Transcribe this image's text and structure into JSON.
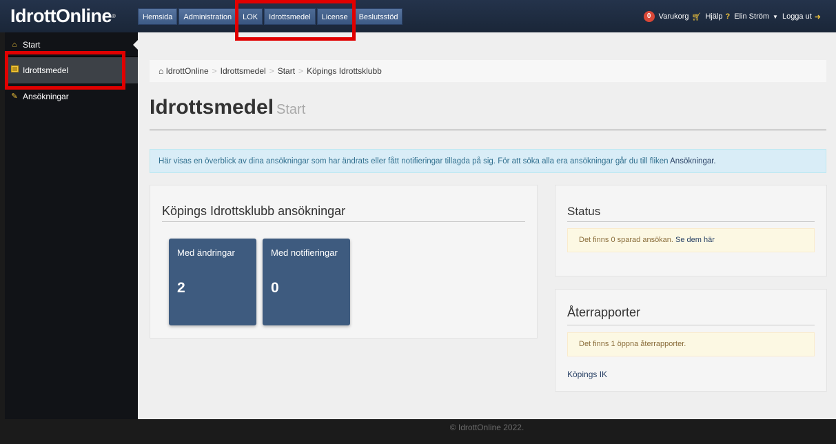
{
  "header": {
    "logo_text": "IdrottOnline",
    "nav": [
      "Hemsida",
      "Administration",
      "LOK",
      "Idrottsmedel",
      "License",
      "Beslutsstöd"
    ],
    "cart_count": "0",
    "cart_label": "Varukorg",
    "help_label": "Hjälp",
    "user_name": "Elin Ström",
    "logout_label": "Logga ut"
  },
  "sidebar": {
    "items": [
      {
        "label": "Start",
        "icon": "home-icon"
      },
      {
        "label": "Idrottsmedel",
        "icon": "list-icon"
      },
      {
        "label": "Ansökningar",
        "icon": "pencil-icon"
      }
    ]
  },
  "breadcrumb": [
    "IdrottOnline",
    "Idrottsmedel",
    "Start",
    "Köpings Idrottsklubb"
  ],
  "page": {
    "title": "Idrottsmedel",
    "subtitle": "Start",
    "info_text": "Här visas en överblick av dina ansökningar som har ändrats eller fått notifieringar tillagda på sig. För att söka alla era ansökningar går du till fliken",
    "info_link": "Ansökningar."
  },
  "applications_panel": {
    "title": "Köpings Idrottsklubb ansökningar",
    "tiles": [
      {
        "label": "Med ändringar",
        "count": "2"
      },
      {
        "label": "Med notifieringar",
        "count": "0"
      }
    ]
  },
  "status_panel": {
    "title": "Status",
    "message": "Det finns 0 sparad ansökan.",
    "link": "Se dem här"
  },
  "reports_panel": {
    "title": "Återrapporter",
    "message": "Det finns 1 öppna återrapporter.",
    "link": "Köpings IK"
  },
  "footer": "© IdrottOnline 2022.",
  "colors": {
    "topbar": "#1f2d44",
    "tile": "#3e5b7f",
    "highlight": "#e10000",
    "info_bg": "#d9edf7",
    "warning_bg": "#fcf8e3"
  }
}
